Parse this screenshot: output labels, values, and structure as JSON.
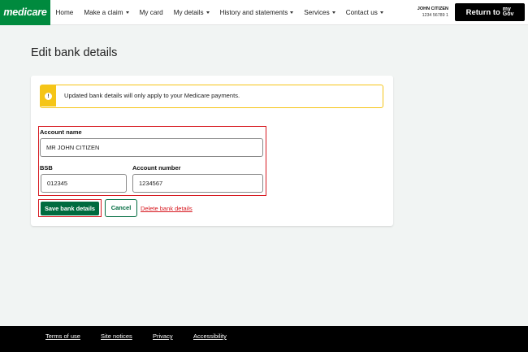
{
  "header": {
    "logo": "medicare",
    "nav": [
      {
        "label": "Home",
        "dropdown": false
      },
      {
        "label": "Make a claim",
        "dropdown": true
      },
      {
        "label": "My card",
        "dropdown": false
      },
      {
        "label": "My details",
        "dropdown": true
      },
      {
        "label": "History and statements",
        "dropdown": true
      },
      {
        "label": "Services",
        "dropdown": true
      },
      {
        "label": "Contact us",
        "dropdown": true
      }
    ],
    "user_name": "JOHN CITIZEN",
    "user_number": "1234 56789 1",
    "return_label": "Return to",
    "mygov_top": "my",
    "mygov_bottom": "Gov"
  },
  "page": {
    "title": "Edit bank details"
  },
  "alert": {
    "icon": "exclamation-icon",
    "text": "Updated bank details will only apply to your Medicare payments."
  },
  "form": {
    "account_name_label": "Account name",
    "account_name_value": "MR JOHN CITIZEN",
    "bsb_label": "BSB",
    "bsb_value": "012345",
    "account_number_label": "Account number",
    "account_number_value": "1234567"
  },
  "actions": {
    "save_label": "Save bank details",
    "cancel_label": "Cancel",
    "delete_label": "Delete bank details"
  },
  "footer": {
    "links": [
      "Terms of use",
      "Site notices",
      "Privacy",
      "Accessibility"
    ]
  },
  "colors": {
    "brand_green": "#008a3e",
    "button_green": "#006b3f",
    "alert_yellow": "#f5c518",
    "highlight_red": "#d71920"
  }
}
